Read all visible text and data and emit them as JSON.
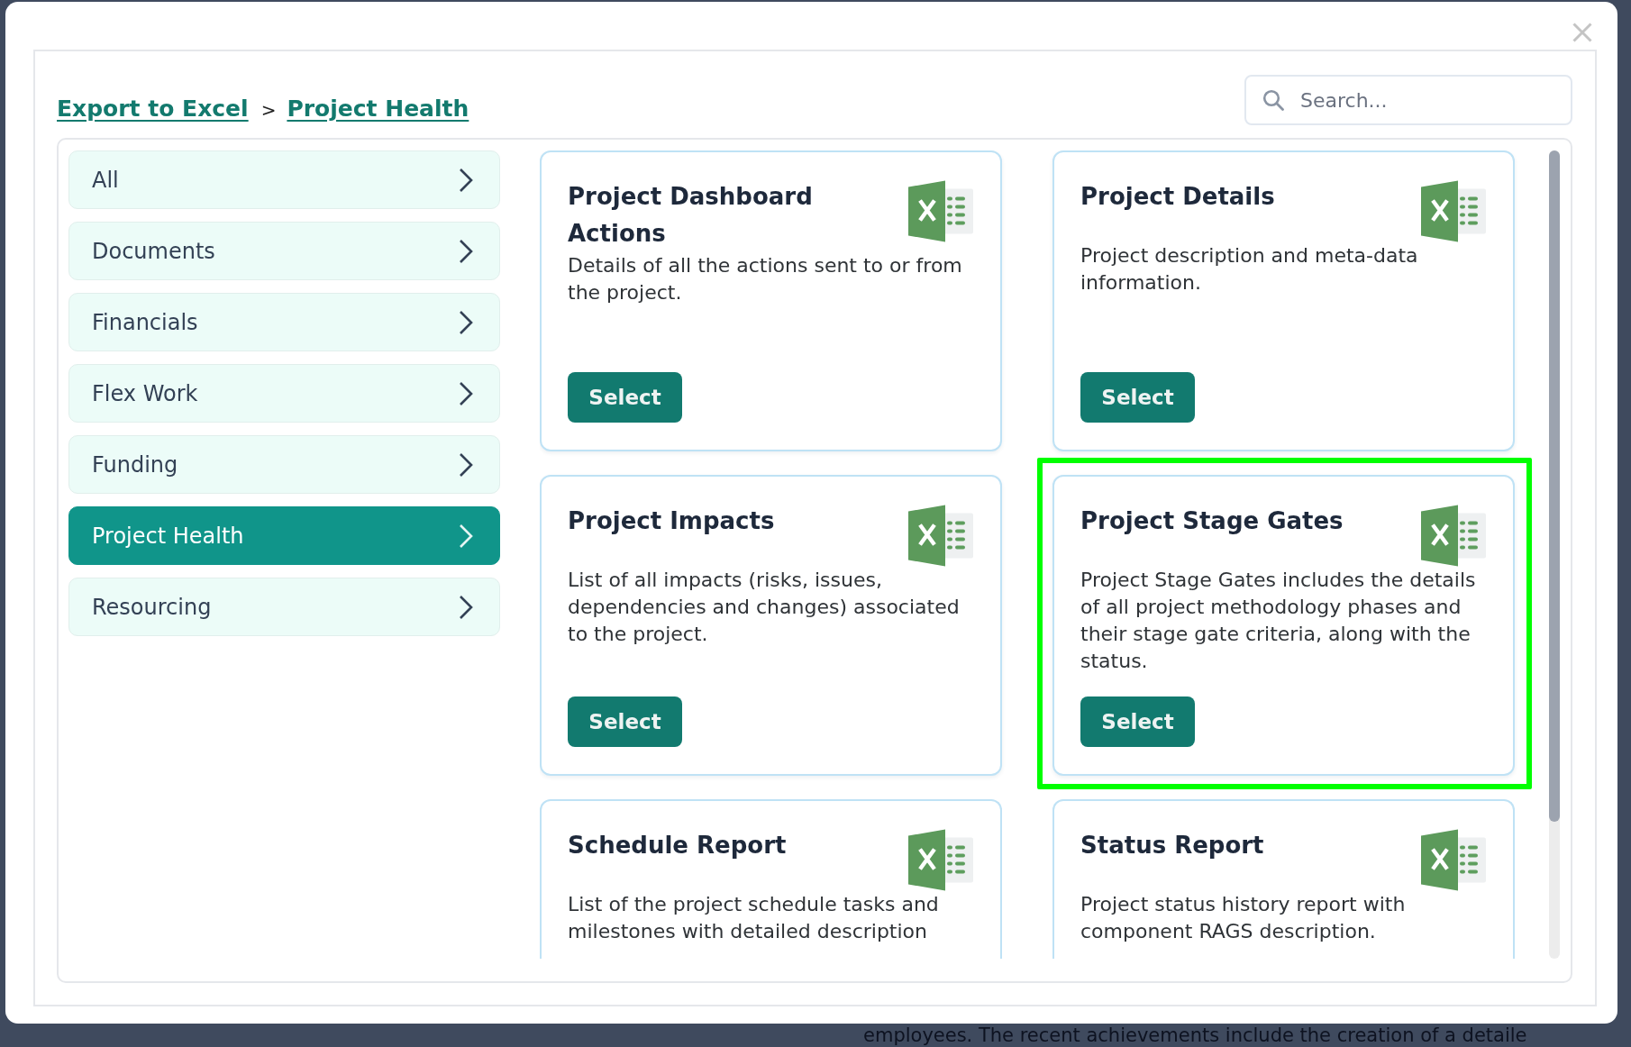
{
  "breadcrumb": {
    "items": [
      {
        "label": "Export to Excel"
      },
      {
        "label": "Project Health"
      }
    ],
    "separator": ">"
  },
  "search": {
    "placeholder": "Search..."
  },
  "sidebar": {
    "items": [
      {
        "label": "All",
        "selected": false
      },
      {
        "label": "Documents",
        "selected": false
      },
      {
        "label": "Financials",
        "selected": false
      },
      {
        "label": "Flex Work",
        "selected": false
      },
      {
        "label": "Funding",
        "selected": false
      },
      {
        "label": "Project Health",
        "selected": true
      },
      {
        "label": "Resourcing",
        "selected": false
      }
    ]
  },
  "cards": [
    {
      "title": "Project Dashboard Actions",
      "description": "Details of all the actions sent to or from the project.",
      "button": "Select",
      "highlighted": false
    },
    {
      "title": "Project Details",
      "description": "Project description and meta-data information.",
      "button": "Select",
      "highlighted": false
    },
    {
      "title": "Project Impacts",
      "description": "List of all impacts (risks, issues, dependencies and changes) associated to the project.",
      "button": "Select",
      "highlighted": false
    },
    {
      "title": "Project Stage Gates",
      "description": "Project Stage Gates includes the details of all project methodology phases and their stage gate criteria, along with the status.",
      "button": "Select",
      "highlighted": true
    },
    {
      "title": "Schedule Report",
      "description": "List of the project schedule tasks and milestones with detailed description",
      "highlighted": false
    },
    {
      "title": "Status Report",
      "description": "Project status history report with component RAGS description.",
      "highlighted": false
    }
  ],
  "background_page": {
    "text": "employees. The recent achievements include the creation of a detaile"
  }
}
